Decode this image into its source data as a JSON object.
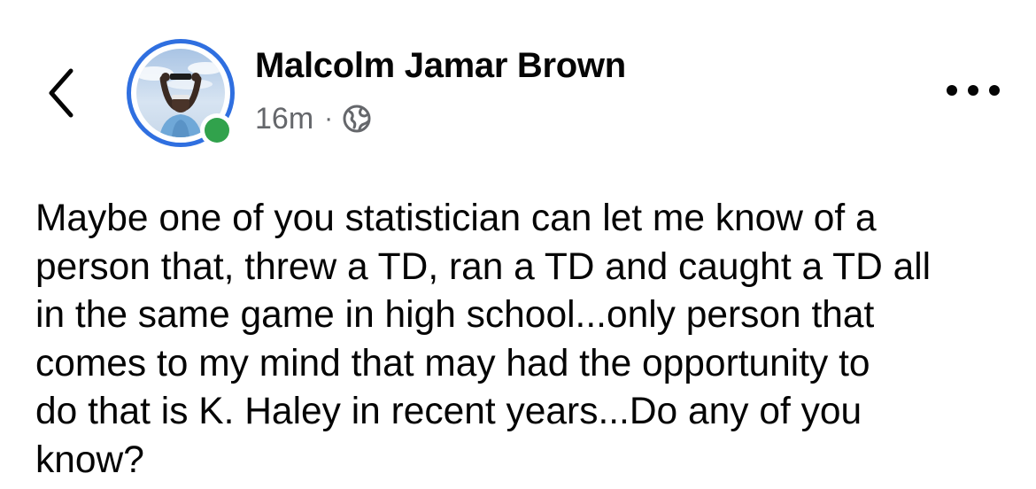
{
  "header": {
    "back_icon": "chevron-left-icon",
    "author_name": "Malcolm Jamar Brown",
    "timestamp": "16m",
    "separator": "·",
    "audience_icon": "globe-icon",
    "more_icon": "more-horizontal-icon",
    "online": true
  },
  "colors": {
    "ring": "#2f6fe0",
    "online": "#31a24c",
    "meta_text": "#65676b",
    "body_text": "#050505"
  },
  "post": {
    "text": "Maybe one of you statistician can let me know of a\nperson that, threw a TD, ran a TD and caught a TD all\nin the same game in high school...only person that\ncomes to my mind that may had the opportunity to\ndo that is K. Haley in recent years...Do any of you\nknow?"
  }
}
